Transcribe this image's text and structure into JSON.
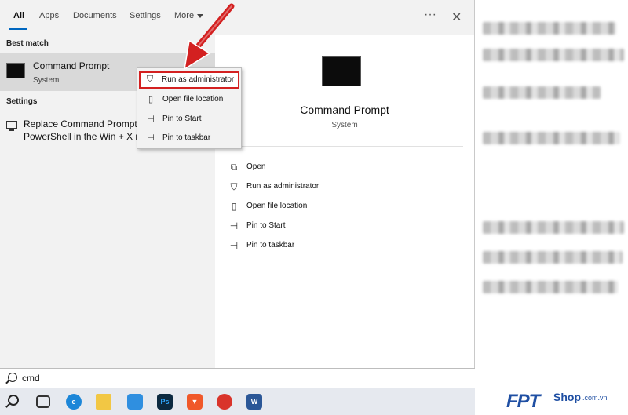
{
  "tabs": {
    "all": "All",
    "apps": "Apps",
    "documents": "Documents",
    "settings": "Settings",
    "more": "More"
  },
  "header": {
    "more_icon": "···",
    "close_icon": "✕"
  },
  "left": {
    "best_match_title": "Best match",
    "best_item": {
      "name": "Command Prompt",
      "type": "System"
    },
    "settings_title": "Settings",
    "settings_item_text": "Replace Command Prompt with Windows PowerShell in the Win + X menu"
  },
  "right": {
    "title": "Command Prompt",
    "subtitle": "System",
    "actions": [
      {
        "label": "Open",
        "icon": "open-icon"
      },
      {
        "label": "Run as administrator",
        "icon": "shield-icon"
      },
      {
        "label": "Open file location",
        "icon": "file-location-icon"
      },
      {
        "label": "Pin to Start",
        "icon": "pin-icon"
      },
      {
        "label": "Pin to taskbar",
        "icon": "pin-icon"
      }
    ]
  },
  "context_menu": {
    "items": [
      {
        "label": "Run as administrator",
        "icon": "shield-icon",
        "highlighted": true
      },
      {
        "label": "Open file location",
        "icon": "file-location-icon"
      },
      {
        "label": "Pin to Start",
        "icon": "pin-icon"
      },
      {
        "label": "Pin to taskbar",
        "icon": "pin-icon"
      }
    ]
  },
  "search": {
    "value": "cmd"
  },
  "taskbar": {
    "icons": [
      "task-view-icon",
      "edge-icon",
      "file-explorer-icon",
      "store-icon",
      "photoshop-icon",
      "brave-icon",
      "app-icon",
      "word-icon"
    ]
  },
  "watermark": {
    "brand": "FPT",
    "shop": "Shop",
    "domain": ".com.vn"
  },
  "colors": {
    "accent": "#0067c0",
    "highlight": "#d32020",
    "brand": "#1f4fa3"
  }
}
